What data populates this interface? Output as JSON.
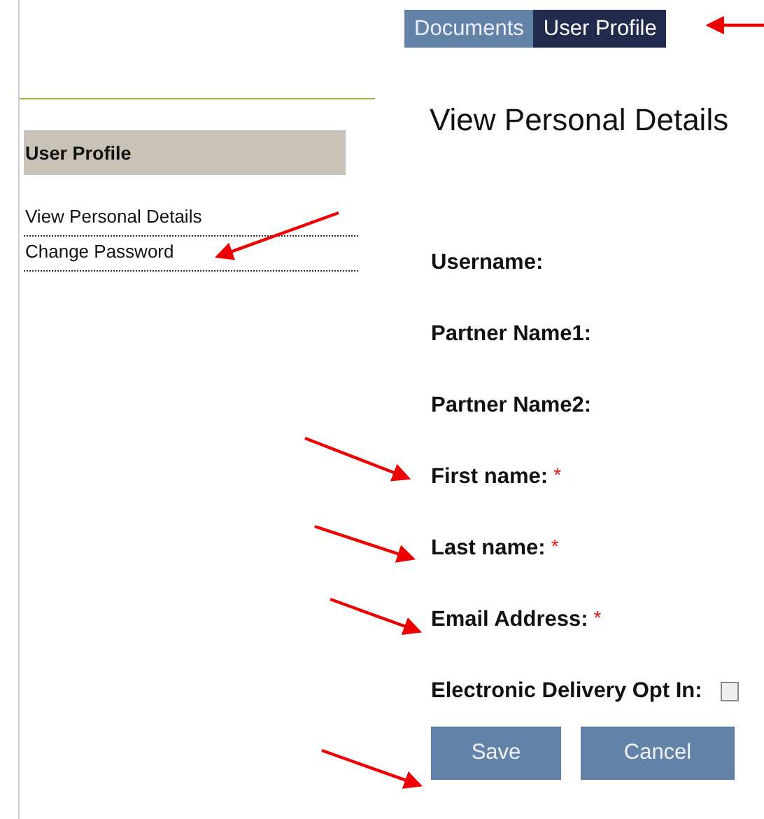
{
  "tabs": [
    {
      "label": "Documents",
      "selected": false
    },
    {
      "label": "User Profile",
      "selected": true
    }
  ],
  "sidebar": {
    "header": "User Profile",
    "items": [
      {
        "label": "View Personal Details"
      },
      {
        "label": "Change Password"
      }
    ]
  },
  "page_title": "View Personal Details",
  "form": {
    "fields": [
      {
        "label": "Username:"
      },
      {
        "label": "Partner Name1:"
      },
      {
        "label": "Partner Name2:"
      },
      {
        "label": "First name:",
        "required_mark": "*"
      },
      {
        "label": "Last name:",
        "required_mark": "*"
      },
      {
        "label": "Email Address:",
        "required_mark": "*"
      },
      {
        "label": "Electronic Delivery Opt In:",
        "kind": "checkbox",
        "checked": false
      }
    ]
  },
  "buttons": [
    "Save",
    "Cancel"
  ]
}
